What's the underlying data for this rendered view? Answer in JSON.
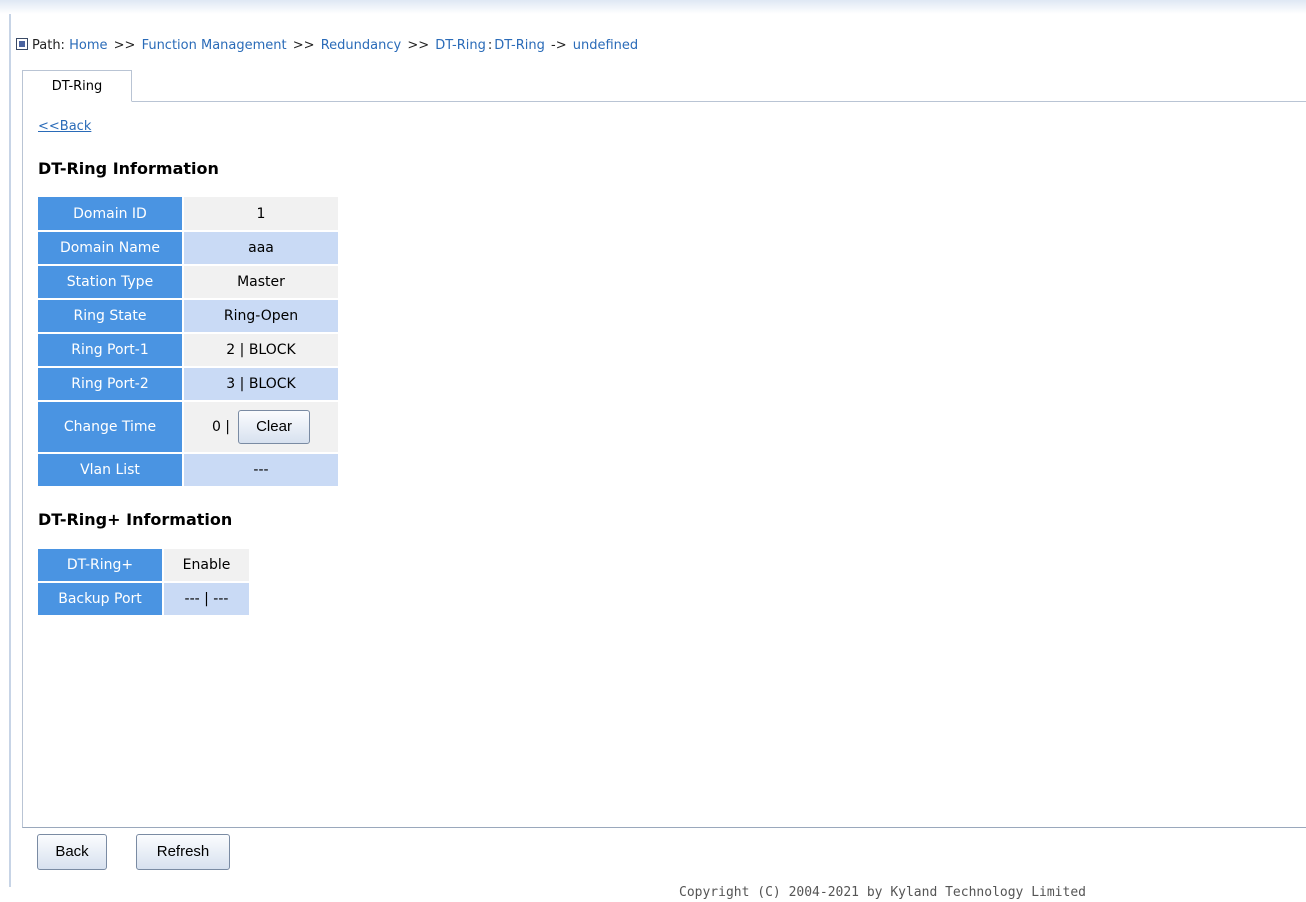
{
  "path": {
    "label": "Path:",
    "items": [
      "Home",
      "Function Management",
      "Redundancy",
      "DT-Ring"
    ],
    "separator": ">>",
    "suffix_sep": ":",
    "current": "DT-Ring",
    "arrow": "->",
    "tail": "undefined"
  },
  "tabs": [
    "DT-Ring"
  ],
  "back_link": "<<Back",
  "dtring": {
    "title": "DT-Ring Information",
    "rows": [
      {
        "label": "Domain ID",
        "value": "1"
      },
      {
        "label": "Domain Name",
        "value": "aaa"
      },
      {
        "label": "Station Type",
        "value": "Master"
      },
      {
        "label": "Ring State",
        "value": "Ring-Open"
      },
      {
        "label": "Ring Port-1",
        "value": "2 | BLOCK"
      },
      {
        "label": "Ring Port-2",
        "value": "3 | BLOCK"
      },
      {
        "label": "Change Time",
        "value": "0 |",
        "button": "Clear"
      },
      {
        "label": "Vlan List",
        "value": "---"
      }
    ]
  },
  "dtring_plus": {
    "title": "DT-Ring+ Information",
    "rows": [
      {
        "label": "DT-Ring+",
        "value": "Enable"
      },
      {
        "label": "Backup Port",
        "value": "--- | ---"
      }
    ]
  },
  "footer": {
    "back_button": "Back",
    "refresh_button": "Refresh",
    "copyright": "Copyright (C) 2004-2021 by Kyland Technology Limited"
  },
  "colors": {
    "header_cell": "#4a94e2",
    "row_even": "#c9daf5",
    "row_odd": "#f1f1f1",
    "link": "#2a6bb8"
  }
}
